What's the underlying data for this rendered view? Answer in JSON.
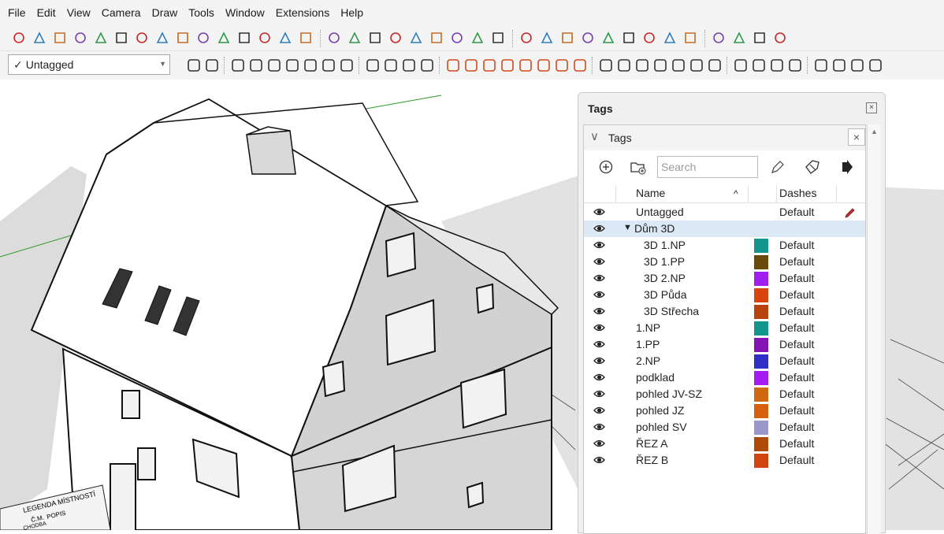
{
  "menu": [
    "File",
    "Edit",
    "View",
    "Camera",
    "Draw",
    "Tools",
    "Window",
    "Extensions",
    "Help"
  ],
  "tag_dropdown": {
    "check": "✓",
    "value": "Untagged"
  },
  "icons": {
    "toolbar1": [
      "pencil",
      "freehand",
      "rectangle",
      "rotated-rectangle",
      "circle",
      "polygon",
      "arc",
      "two-point-arc",
      "pie",
      "three-point-arc",
      "push-pull",
      "follow-me",
      "offset",
      "text",
      "axes",
      "3d-text",
      "move",
      "rotate",
      "scale",
      "follow-me-alt",
      "section-plane",
      "protractor",
      "dimension",
      "orbit",
      "pan",
      "zoom",
      "zoom-window",
      "zoom-extents",
      "previous",
      "walk",
      "look-around",
      "position-camera",
      "iso-view",
      "top-view",
      "front-view",
      "right-view",
      "back-view"
    ],
    "toolbar2_colors": [
      "#333333",
      "#d04a1a",
      "#555555"
    ]
  },
  "tray": {
    "title": "Tags"
  },
  "panel": {
    "title": "Tags",
    "search_placeholder": "Search",
    "col_name": "Name",
    "col_sort": "^",
    "col_dashes": "Dashes"
  },
  "tags": [
    {
      "name": "Untagged",
      "dashes": "Default",
      "color": "",
      "indent": 0,
      "active": true
    },
    {
      "name": "Dům 3D",
      "dashes": "",
      "color": "",
      "indent": 0,
      "folder": true,
      "selected": true
    },
    {
      "name": "3D 1.NP",
      "dashes": "Default",
      "color": "#12958a",
      "indent": 1
    },
    {
      "name": "3D 1.PP",
      "dashes": "Default",
      "color": "#6a4a0a",
      "indent": 1
    },
    {
      "name": "3D 2.NP",
      "dashes": "Default",
      "color": "#a01ef0",
      "indent": 1
    },
    {
      "name": "3D Půda",
      "dashes": "Default",
      "color": "#d8440e",
      "indent": 1
    },
    {
      "name": "3D Střecha",
      "dashes": "Default",
      "color": "#b8420c",
      "indent": 1
    },
    {
      "name": "1.NP",
      "dashes": "Default",
      "color": "#12958a",
      "indent": 0
    },
    {
      "name": "1.PP",
      "dashes": "Default",
      "color": "#8412b4",
      "indent": 0
    },
    {
      "name": "2.NP",
      "dashes": "Default",
      "color": "#3030c8",
      "indent": 0
    },
    {
      "name": "podklad",
      "dashes": "Default",
      "color": "#a31cf2",
      "indent": 0
    },
    {
      "name": "pohled JV-SZ",
      "dashes": "Default",
      "color": "#d06810",
      "indent": 0
    },
    {
      "name": "pohled JZ",
      "dashes": "Default",
      "color": "#d6600c",
      "indent": 0
    },
    {
      "name": "pohled SV",
      "dashes": "Default",
      "color": "#9a98c8",
      "indent": 0
    },
    {
      "name": "ŘEZ A",
      "dashes": "Default",
      "color": "#b04a08",
      "indent": 0
    },
    {
      "name": "ŘEZ B",
      "dashes": "Default",
      "color": "#d44410",
      "indent": 0
    }
  ],
  "viewport": {
    "legend_title": "LEGENDA MÍSTNOSTÍ",
    "legend_col1": "Č.M.",
    "legend_col2": "POPIS",
    "legend_row1": "CHODBA"
  }
}
